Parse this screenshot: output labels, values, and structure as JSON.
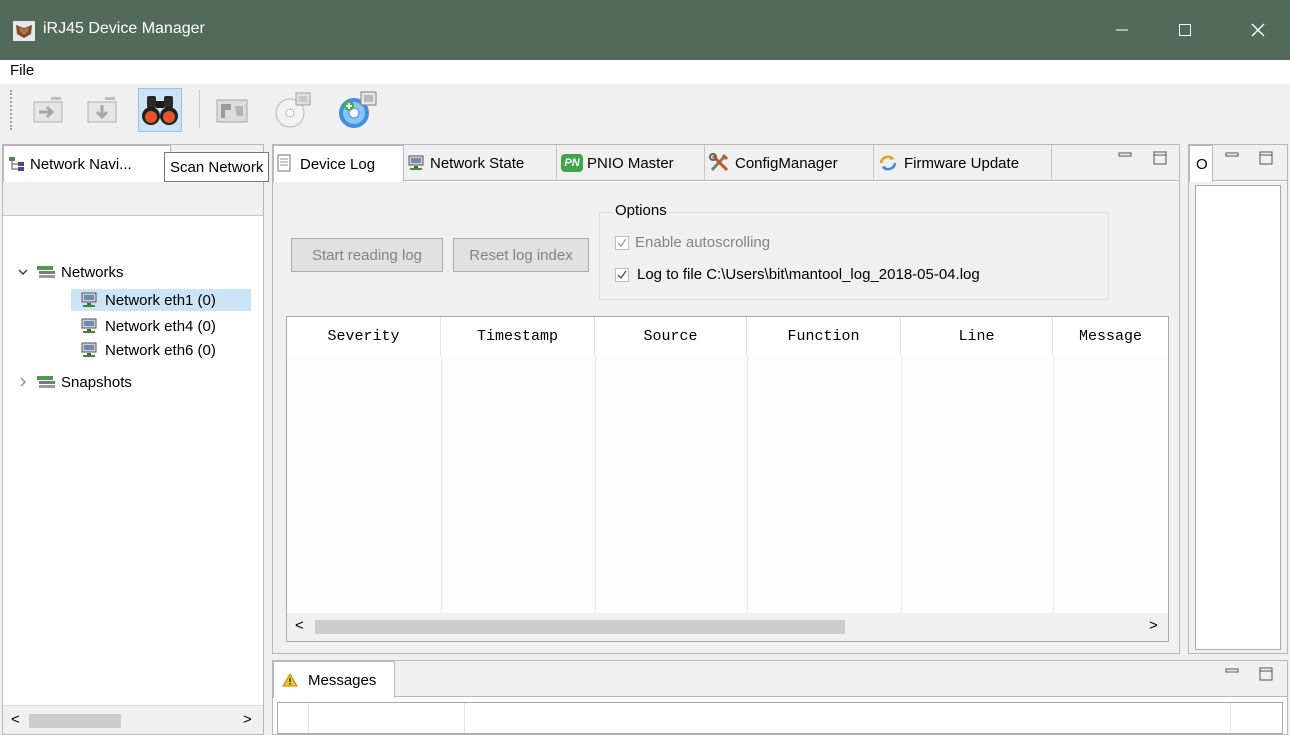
{
  "window": {
    "title": "iRJ45 Device Manager",
    "minimize_glyph": "—",
    "maximize_glyph": "☐",
    "close_glyph": "✕"
  },
  "menu": {
    "file": "File"
  },
  "toolbar": {
    "buttons": [
      {
        "icon": "import-device-icon",
        "enabled": false
      },
      {
        "icon": "export-device-icon",
        "enabled": false
      },
      {
        "icon": "binoculars-icon",
        "enabled": true,
        "hot": true
      },
      {
        "icon": "map-icon",
        "enabled": false
      },
      {
        "icon": "disk-icon",
        "enabled": false
      },
      {
        "icon": "disk-add-icon",
        "enabled": true
      }
    ],
    "tooltip": "Scan Network"
  },
  "navigator": {
    "tab_label": "Network Navi...",
    "tree": {
      "networks_label": "Networks",
      "networks": [
        "Network eth1 (0)",
        "Network eth4 (0)",
        "Network eth6 (0)"
      ],
      "snapshots_label": "Snapshots"
    },
    "scroll_left": "<",
    "scroll_right": ">"
  },
  "editor_tabs": [
    {
      "label": "Device Log",
      "icon": "document-icon",
      "active": true
    },
    {
      "label": "Network State",
      "icon": "monitor-icon"
    },
    {
      "label": "PNIO Master",
      "icon": "pn-icon",
      "badge": "PN"
    },
    {
      "label": "ConfigManager",
      "icon": "tools-icon"
    },
    {
      "label": "Firmware Update",
      "icon": "update-icon"
    }
  ],
  "device_log": {
    "start_button": "Start reading log",
    "reset_button": "Reset log index",
    "options_title": "Options",
    "autoscroll_label": "Enable autoscrolling",
    "logfile_label": "Log to file C:\\Users\\bit\\mantool_log_2018-05-04.log",
    "columns": [
      "Severity",
      "Timestamp",
      "Source",
      "Function",
      "Line",
      "Message"
    ],
    "scroll_left": "<",
    "scroll_right": ">"
  },
  "right_panel": {
    "tab_label": "O"
  },
  "messages": {
    "tab_label": "Messages"
  },
  "colors": {
    "titlebar": "#526a59",
    "selection": "#cce4f7",
    "hot": "#cde3f7"
  }
}
